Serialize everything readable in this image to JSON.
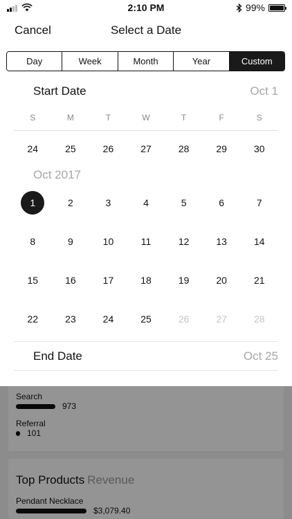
{
  "status_bar": {
    "time": "2:10 PM",
    "battery": "99%",
    "battery_level": 0.99
  },
  "nav": {
    "cancel_label": "Cancel",
    "title": "Select a Date"
  },
  "segments": [
    {
      "label": "Day",
      "active": false
    },
    {
      "label": "Week",
      "active": false
    },
    {
      "label": "Month",
      "active": false
    },
    {
      "label": "Year",
      "active": false
    },
    {
      "label": "Custom",
      "active": true
    }
  ],
  "start_date": {
    "label": "Start Date",
    "value": "Oct 1"
  },
  "weekdays": [
    "S",
    "M",
    "T",
    "W",
    "T",
    "F",
    "S"
  ],
  "calendar": {
    "prev_week": [
      "24",
      "25",
      "26",
      "27",
      "28",
      "29",
      "30"
    ],
    "month_label": "Oct 2017",
    "weeks": [
      [
        "1",
        "2",
        "3",
        "4",
        "5",
        "6",
        "7"
      ],
      [
        "8",
        "9",
        "10",
        "11",
        "12",
        "13",
        "14"
      ],
      [
        "15",
        "16",
        "17",
        "18",
        "19",
        "20",
        "21"
      ],
      [
        "22",
        "23",
        "24",
        "25",
        "26",
        "27",
        "28"
      ]
    ],
    "selected": "1",
    "disabled": [
      "26",
      "27",
      "28"
    ]
  },
  "end_date": {
    "label": "End Date",
    "value": "Oct 25"
  },
  "background": {
    "sources": [
      {
        "label": "Search",
        "value": "973"
      },
      {
        "label": "Referral",
        "value": "101"
      }
    ],
    "top_products": {
      "title": "Top Products",
      "subtitle": "Revenue"
    },
    "products": [
      {
        "name": "Pendant Necklace",
        "value": "$3,079.40"
      }
    ]
  }
}
